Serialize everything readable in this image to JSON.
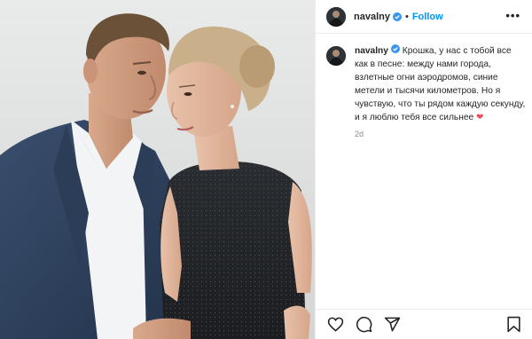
{
  "post": {
    "photo_alt": "",
    "header": {
      "username": "navalny",
      "separator": "•",
      "follow_label": "Follow",
      "more_label": "•••"
    },
    "caption": {
      "username": "navalny",
      "text": "Крошка, у нас с тобой все как в песне: между нами города, взлетные огни аэродромов, синие метели и тысячи километров. Но я чувствую, что ты рядом каждую секунду, и я люблю тебя все сильнее",
      "heart": "❤",
      "time": "2d"
    },
    "actions": {
      "icons": [
        "heart-outline-icon",
        "comment-icon",
        "share-icon",
        "bookmark-icon"
      ]
    },
    "colors": {
      "link_blue": "#0095f6",
      "verified_blue": "#3897f0",
      "heart_red": "#ed4956",
      "muted_gray": "#8e8e8e"
    }
  }
}
